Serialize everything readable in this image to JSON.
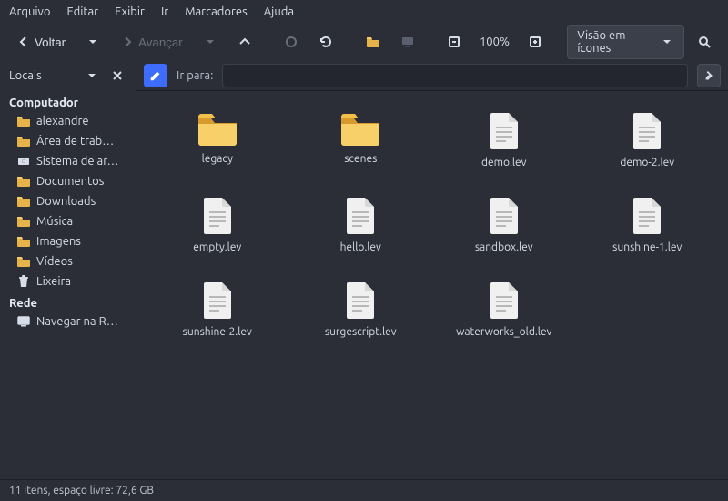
{
  "menubar": [
    "Arquivo",
    "Editar",
    "Exibir",
    "Ir",
    "Marcadores",
    "Ajuda"
  ],
  "toolbar": {
    "back_label": "Voltar",
    "forward_label": "Avançar",
    "zoom_label": "100%",
    "view_combo_label": "Visão em ícones"
  },
  "sidebar": {
    "title": "Locais",
    "sections": [
      {
        "heading": "Computador",
        "items": [
          {
            "icon": "folder",
            "label": "alexandre"
          },
          {
            "icon": "folder",
            "label": "Área de trab…"
          },
          {
            "icon": "disk",
            "label": "Sistema de ar…"
          },
          {
            "icon": "folder",
            "label": "Documentos"
          },
          {
            "icon": "folder",
            "label": "Downloads"
          },
          {
            "icon": "folder",
            "label": "Música"
          },
          {
            "icon": "folder",
            "label": "Imagens"
          },
          {
            "icon": "folder",
            "label": "Vídeos"
          },
          {
            "icon": "trash",
            "label": "Lixeira"
          }
        ]
      },
      {
        "heading": "Rede",
        "items": [
          {
            "icon": "network",
            "label": "Navegar na R…"
          }
        ]
      }
    ]
  },
  "pathbar": {
    "goto_label": "Ir para:"
  },
  "files": [
    {
      "type": "folder",
      "name": "legacy"
    },
    {
      "type": "folder",
      "name": "scenes"
    },
    {
      "type": "file",
      "name": "demo.lev"
    },
    {
      "type": "file",
      "name": "demo-2.lev"
    },
    {
      "type": "file",
      "name": "empty.lev"
    },
    {
      "type": "file",
      "name": "hello.lev"
    },
    {
      "type": "file",
      "name": "sandbox.lev"
    },
    {
      "type": "file",
      "name": "sunshine-1.lev"
    },
    {
      "type": "file",
      "name": "sunshine-2.lev"
    },
    {
      "type": "file",
      "name": "surgescript.lev"
    },
    {
      "type": "file",
      "name": "waterworks_old.lev"
    }
  ],
  "statusbar": "11 itens, espaço livre: 72,6 GB"
}
